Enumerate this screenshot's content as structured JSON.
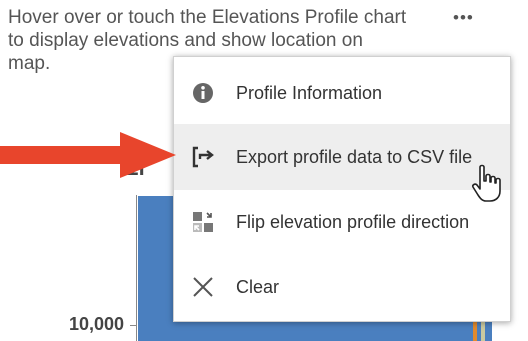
{
  "instructions": {
    "line1": "Hover over or touch the Elevations Profile chart",
    "line2": "to display elevations and show location on",
    "line3": "map.",
    "more_glyph": "•••"
  },
  "chart": {
    "title_fragment": "El",
    "y_tick_label": "10,000",
    "fill_color": "#4a7fbf"
  },
  "menu": {
    "items": [
      {
        "label": "Profile Information",
        "icon": "info-icon"
      },
      {
        "label": "Export profile data to CSV file",
        "icon": "export-icon",
        "hovered": true
      },
      {
        "label": "Flip elevation profile direction",
        "icon": "flip-icon"
      },
      {
        "label": "Clear",
        "icon": "close-icon"
      }
    ]
  },
  "annotation": {
    "arrow_color": "#e8452c",
    "pointer": "hand-cursor-icon"
  }
}
